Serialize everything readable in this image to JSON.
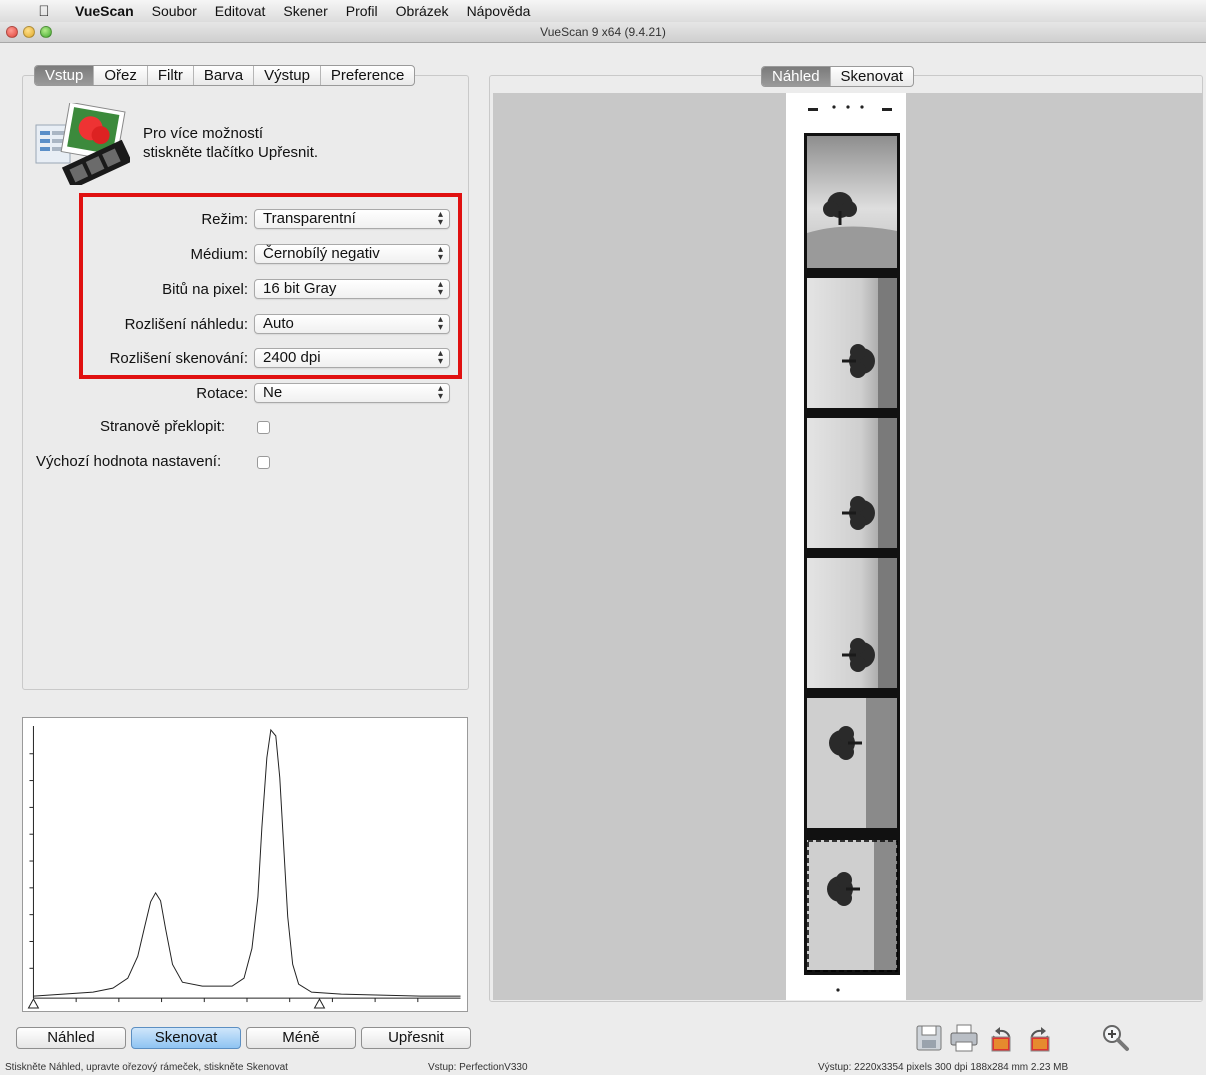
{
  "menubar": {
    "app_name": "VueScan",
    "items": [
      "Soubor",
      "Editovat",
      "Skener",
      "Profil",
      "Obrázek",
      "Nápověda"
    ]
  },
  "window": {
    "title": "VueScan 9 x64 (9.4.21)"
  },
  "left_tabs": [
    {
      "label": "Vstup",
      "active": true
    },
    {
      "label": "Ořez",
      "active": false
    },
    {
      "label": "Filtr",
      "active": false
    },
    {
      "label": "Barva",
      "active": false
    },
    {
      "label": "Výstup",
      "active": false
    },
    {
      "label": "Preference",
      "active": false
    }
  ],
  "hint": {
    "line1": "Pro více možností",
    "line2": "stiskněte tlačítko Upřesnit."
  },
  "settings": {
    "mode": {
      "label": "Režim:",
      "value": "Transparentní"
    },
    "media": {
      "label": "Médium:",
      "value": "Černobílý negativ"
    },
    "bits": {
      "label": "Bitů na pixel:",
      "value": "16 bit Gray"
    },
    "preview_res": {
      "label": "Rozlišení náhledu:",
      "value": "Auto"
    },
    "scan_res": {
      "label": "Rozlišení skenování:",
      "value": "2400 dpi"
    },
    "rotation": {
      "label": "Rotace:",
      "value": "Ne"
    },
    "mirror": {
      "label": "Stranově překlopit:",
      "checked": false
    },
    "defaults": {
      "label": "Výchozí hodnota nastavení:",
      "checked": false
    }
  },
  "buttons": {
    "preview": "Náhled",
    "scan": "Skenovat",
    "less": "Méně",
    "more": "Upřesnit"
  },
  "right_tabs": [
    {
      "label": "Náhled",
      "active": true
    },
    {
      "label": "Skenovat",
      "active": false
    }
  ],
  "toolbar_icons": [
    "save-icon",
    "print-icon",
    "rotate-left-icon",
    "rotate-right-icon",
    "zoom-in-icon"
  ],
  "status": {
    "hint": "Stiskněte Náhled, upravte ořezový rámeček, stiskněte Skenovat",
    "input": "Vstup: PerfectionV330",
    "output": "Výstup: 2220x3354 pixels 300 dpi 188x284 mm 2.23 MB"
  },
  "colors": {
    "highlight": "#e01010",
    "active_tab": "#8a8a8a",
    "default_button": "#8fc4f2"
  }
}
